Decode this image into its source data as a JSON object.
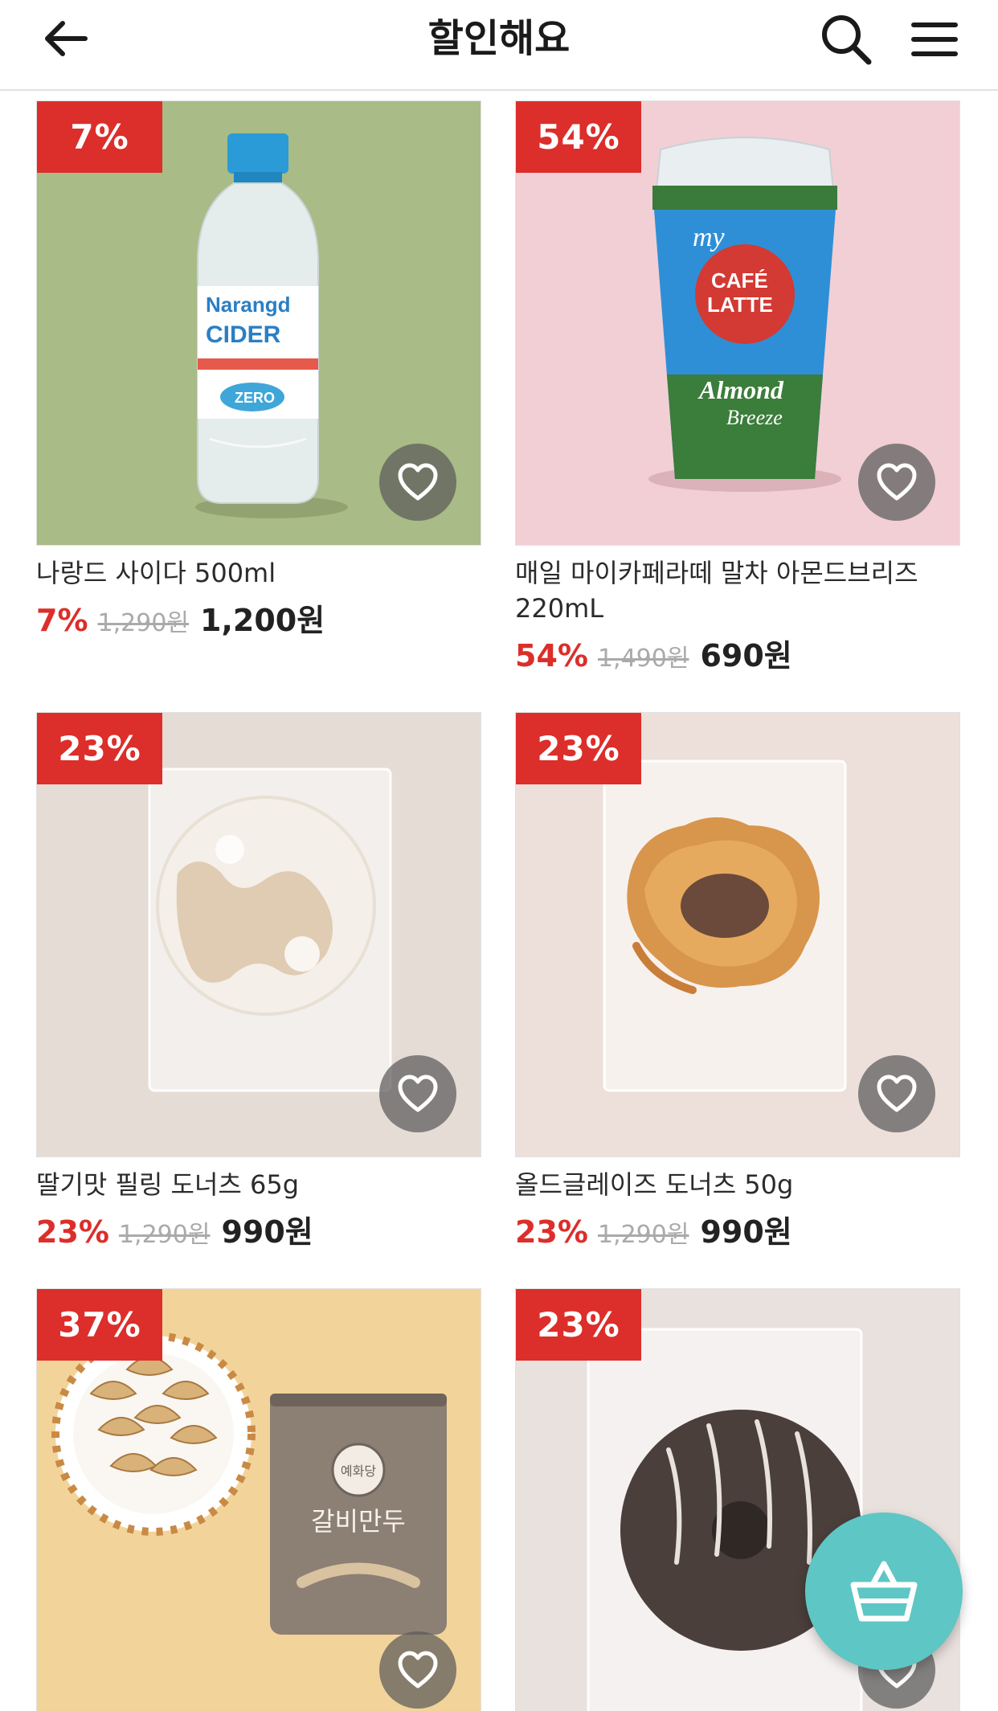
{
  "header": {
    "title": "할인해요"
  },
  "colors": {
    "accent": "#dc2e2a",
    "basket": "#5ec6c4"
  },
  "products": [
    {
      "badge": "7%",
      "name": "나랑드 사이다 500ml",
      "discount": "7%",
      "original_price": "1,290원",
      "price": "1,200원",
      "image": "cider-bottle",
      "bg": "#a9bb86"
    },
    {
      "badge": "54%",
      "name": "매일 마이카페라떼 말차 아몬드브리즈 220mL",
      "discount": "54%",
      "original_price": "1,490원",
      "price": "690원",
      "image": "latte-cup",
      "bg": "#f1cfd5"
    },
    {
      "badge": "23%",
      "name": "딸기맛 필링 도너츠 65g",
      "discount": "23%",
      "original_price": "1,290원",
      "price": "990원",
      "image": "sugar-donut",
      "bg": "#e5dcd6"
    },
    {
      "badge": "23%",
      "name": "올드글레이즈 도너츠 50g",
      "discount": "23%",
      "original_price": "1,290원",
      "price": "990원",
      "image": "glazed-donut",
      "bg": "#eddfd9"
    },
    {
      "badge": "37%",
      "name": "",
      "discount": "",
      "original_price": "",
      "price": "",
      "image": "dumplings",
      "bg": "#f2d49a",
      "package_text": "갈비만두",
      "brand_text": "예화당"
    },
    {
      "badge": "23%",
      "name": "",
      "discount": "",
      "original_price": "",
      "price": "",
      "image": "choco-donut",
      "bg": "#e9e1dd"
    }
  ]
}
